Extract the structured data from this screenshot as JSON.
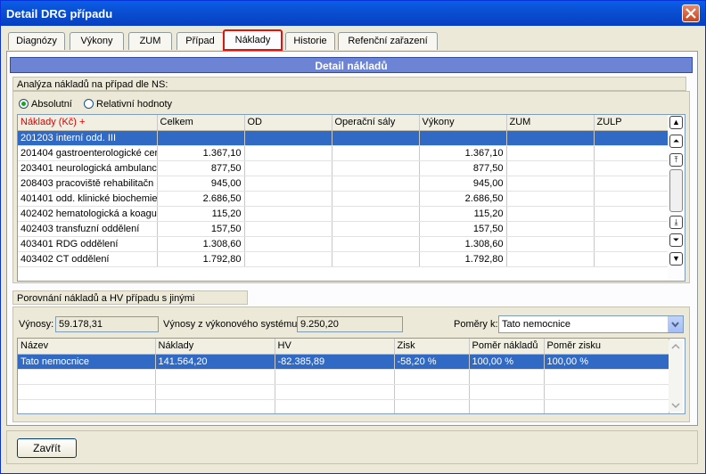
{
  "window": {
    "title": "Detail DRG případu"
  },
  "tabs": [
    {
      "label": "Diagnózy"
    },
    {
      "label": "Výkony"
    },
    {
      "label": "ZUM"
    },
    {
      "label": "Případ"
    },
    {
      "label": "Náklady"
    },
    {
      "label": "Historie"
    },
    {
      "label": "Refenční zařazení"
    }
  ],
  "detail": {
    "header": "Detail nákladů",
    "analysis_label": "Analýza nákladů na případ dle NS:",
    "radio_absolute": "Absolutní",
    "radio_relative": "Relativní hodnoty",
    "selected_mode": "Absolutní"
  },
  "cost_table": {
    "columns": [
      "Náklady (Kč) +",
      "Celkem",
      "OD",
      "Operační sály",
      "Výkony",
      "ZUM",
      "ZULP"
    ],
    "rows": [
      [
        "201203 interní odd. III",
        "",
        "",
        "",
        "",
        "",
        ""
      ],
      [
        "201404 gastroenterologické cer",
        "1.367,10",
        "",
        "",
        "1.367,10",
        "",
        ""
      ],
      [
        "203401 neurologická ambulanc",
        "877,50",
        "",
        "",
        "877,50",
        "",
        ""
      ],
      [
        "208403 pracoviště rehabilitačn",
        "945,00",
        "",
        "",
        "945,00",
        "",
        ""
      ],
      [
        "401401 odd. klinické biochemie",
        "2.686,50",
        "",
        "",
        "2.686,50",
        "",
        ""
      ],
      [
        "402402 hematologická a koagu",
        "115,20",
        "",
        "",
        "115,20",
        "",
        ""
      ],
      [
        "402403 transfuzní oddělení",
        "157,50",
        "",
        "",
        "157,50",
        "",
        ""
      ],
      [
        "403401 RDG oddělení",
        "1.308,60",
        "",
        "",
        "1.308,60",
        "",
        ""
      ],
      [
        "403402 CT oddělení",
        "1.792,80",
        "",
        "",
        "1.792,80",
        "",
        ""
      ]
    ]
  },
  "comparison": {
    "label": "Porovnání nákladů a HV případu s jinými zařízeními:",
    "revenue_label": "Výnosy:",
    "revenue_value": "59.178,31",
    "system_revenue_label": "Výnosy z výkonového systému:",
    "system_revenue_value": "9.250,20",
    "ratio_label": "Poměry k:",
    "ratio_value": "Tato nemocnice",
    "columns": [
      "Název",
      "Náklady",
      "HV",
      "Zisk",
      "Poměr nákladů",
      "Poměr zisku"
    ],
    "rows": [
      [
        "Tato nemocnice",
        "141.564,20",
        "-82.385,89",
        "-58,20 %",
        "100,00 %",
        "100,00 %"
      ]
    ]
  },
  "footer": {
    "close_label": "Zavřít"
  },
  "colors": {
    "titlebar": "#0a4fd4",
    "section": "#6c84d3",
    "selection": "#316ac5",
    "active_tab_border": "#e0140a"
  }
}
